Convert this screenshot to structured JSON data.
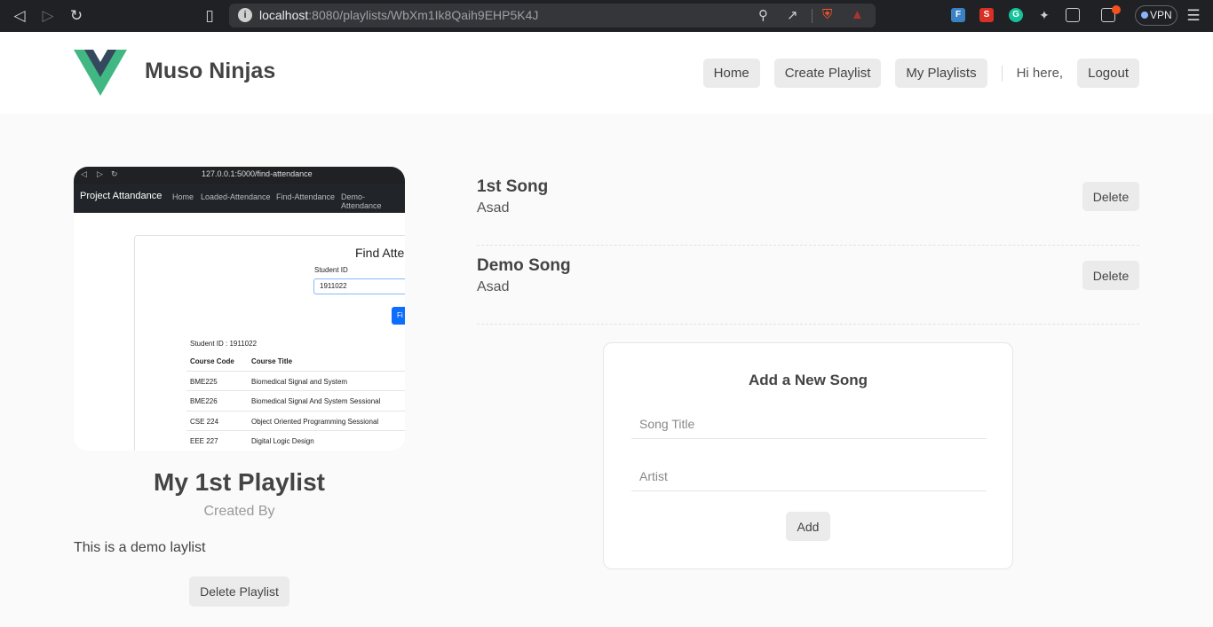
{
  "browser": {
    "url_host": "localhost",
    "url_path": ":8080/playlists/WbXm1Ik8Qaih9EHP5K4J",
    "vpn_label": "VPN",
    "brave_badge": "1"
  },
  "navbar": {
    "brand": "Muso Ninjas",
    "links": [
      "Home",
      "Create Playlist",
      "My Playlists"
    ],
    "greeting": "Hi here,",
    "logout": "Logout"
  },
  "playlist": {
    "title": "My 1st Playlist",
    "created_by": "Created By",
    "description": "This is a demo laylist",
    "delete_label": "Delete Playlist",
    "cover_screenshot": {
      "url": "127.0.0.1:5000/find-attendance",
      "site_title": "Project Attandance",
      "nav": [
        "Home",
        "Loaded-Attendance",
        "Find-Attendance",
        "Demo-Attendance"
      ],
      "heading": "Find Atte",
      "student_id_label": "Student ID",
      "student_id_value": "1911022",
      "button_fragment": "Fi",
      "student_line": "Student ID : 1911022",
      "columns": [
        "Course Code",
        "Course Title"
      ],
      "rows": [
        [
          "BME225",
          "Biomedical Signal and System"
        ],
        [
          "BME226",
          "Biomedical Signal And System Sessional"
        ],
        [
          "CSE 224",
          "Object Oriented Programming Sessional"
        ],
        [
          "EEE 227",
          "Digital Logic Design"
        ]
      ]
    }
  },
  "songs": [
    {
      "title": "1st Song",
      "artist": "Asad",
      "delete": "Delete"
    },
    {
      "title": "Demo Song",
      "artist": "Asad",
      "delete": "Delete"
    }
  ],
  "add_song": {
    "heading": "Add a New Song",
    "title_placeholder": "Song Title",
    "artist_placeholder": "Artist",
    "button": "Add"
  },
  "colors": {
    "logo_outer": "#41b883",
    "logo_inner": "#34495e",
    "page_bg": "#fafafa",
    "button_bg": "#ebebeb"
  }
}
